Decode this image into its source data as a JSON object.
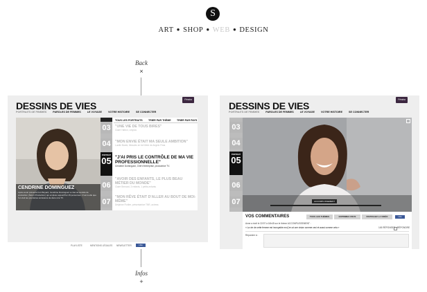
{
  "brand": {
    "logo_letter": "S",
    "nav": [
      "ART",
      "SHOP",
      "WEB",
      "DESIGN"
    ]
  },
  "back": {
    "label": "Back",
    "close_symbol": "×"
  },
  "infos": {
    "label": "Infos",
    "plus_symbol": "+"
  },
  "left_panel": {
    "site_title": "DESSINS DE VIES",
    "subnav": [
      "PORTRAITS DE FEMMES",
      "PAROLES DE FEMMES",
      "LE VOYAGE",
      "VOTRE HISTOIRE",
      "SE CONNECTER"
    ],
    "badge": "Fémina",
    "tabs": [
      "TOUS LES PORTRAITS",
      "TRIER PAR THÈME",
      "TRIER PAR PAYS"
    ],
    "numbers": [
      "03",
      "04",
      "05",
      "06",
      "07"
    ],
    "active_label": "PORTRAIT",
    "entries": [
      {
        "title": "\"UNE VIE DE TOUS BIRES\"",
        "sub": "Claire Hatton, Uniplus"
      },
      {
        "title": "\"MON ENVIE ÉTAIT MA SEULE AMBITION\"",
        "sub": "Lucille Barek, Miracles en bel Mein de Angelo Fima"
      },
      {
        "title": "\"J'AI PRIS LE CONTRÔLE DE MA VIE PROFESSIONNELLE\"",
        "sub": "Cendrine Dominguez, Chef d'entreprise, productrice TV."
      },
      {
        "title": "\"AVOIR DES ENFANTS, LE PLUS BEAU MÉTIER DU MONDE\"",
        "sub": "Claire Bernard, 3 enfants, 1 petits-enfants"
      },
      {
        "title": "\"MON RÊVE ÉTAIT D'ALLER AU BOUT DE MOI-MÊME\"",
        "sub": "Delphine Flottier, présentatrice TNR, actress"
      }
    ],
    "photo_caption_name": "CENDRINE DOMINGUEZ",
    "photo_caption_text": "Après avoir présenté Fort Boyard, Cendrine Dominguez a créé sa société de production (Storm Production) qui emploie aujourd'hui 15 personnes. C'est à elle que l'on doit les premières émissions de déco à la TV."
  },
  "right_panel": {
    "site_title": "DESSINS DE VIES",
    "subnav": [
      "PORTRAITS DE FEMMES",
      "PAROLES DE FEMMES",
      "LE VOYAGE",
      "VOTRE HISTOIRE",
      "SE CONNECTER"
    ],
    "badge": "Fémina",
    "numbers": [
      "03",
      "04",
      "05",
      "06",
      "07"
    ],
    "active_label": "PORTRAIT",
    "video_tag": "ACCOMPLISSEMENT",
    "comments_title": "VOS COMMENTAIRES",
    "comment_tabs": [
      "TOUS LES THÈMES",
      "EXPRIMEZ-VOUS",
      "PARTAGEZ LA VIDÉO"
    ],
    "like": "Like",
    "comment_meta": "Anne a écrit le 22/07 à 16h45 sur le thème ACCOMPLISSEMENT :",
    "comment_body": "« La vie de cette femme est incroyable moi j'en ai une vision comme ceci et aussi comme cela »",
    "replies": "145 RÉPONSES",
    "reply": "RÉPONDRE",
    "reply_label": "Répondre à :"
  },
  "footer_links": [
    "PLAYLISTE",
    "MENTIONS LÉGALES",
    "NEWSLETTER"
  ],
  "footer_like": "Like"
}
